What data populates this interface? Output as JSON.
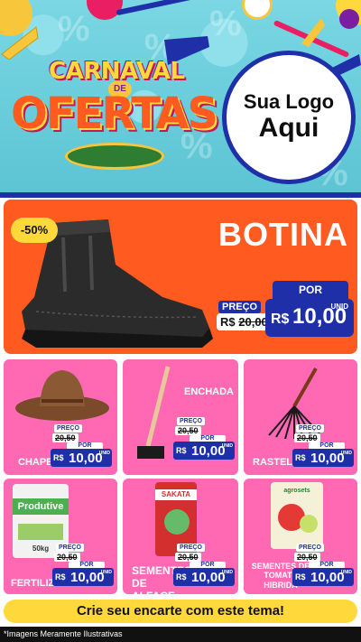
{
  "header": {
    "title_top": "CARNAVAL",
    "title_connector": "DE",
    "title_bottom": "OFERTAS",
    "brand_line1": "Sua Logo",
    "brand_line2": "Aqui"
  },
  "hero": {
    "product": "BOTINA",
    "discount": "-50%",
    "price_label": "PREÇO",
    "old_price_prefix": "R$",
    "old_price": "20,00",
    "por_label": "POR",
    "currency": "R$",
    "new_price": "10,00",
    "unit": "UNID"
  },
  "products": [
    {
      "name": "CHAPEU",
      "price_label": "PREÇO",
      "old_price": "20,50",
      "por_label": "POR",
      "currency": "R$",
      "new_price": "10,00",
      "unit": "UNID"
    },
    {
      "name": "ENCHADA",
      "price_label": "PREÇO",
      "old_price": "20,50",
      "por_label": "POR",
      "currency": "R$",
      "new_price": "10,00",
      "unit": "UNID"
    },
    {
      "name": "RASTELO",
      "price_label": "PREÇO",
      "old_price": "20,50",
      "por_label": "POR",
      "currency": "R$",
      "new_price": "10,00",
      "unit": "UNID"
    },
    {
      "name": "FERTILIZANTES",
      "price_label": "PREÇO",
      "old_price": "20,50",
      "por_label": "POR",
      "currency": "R$",
      "new_price": "10,00",
      "unit": "UNID"
    },
    {
      "name": "SEMENTES DE ALFACE",
      "price_label": "PREÇO",
      "old_price": "20,50",
      "por_label": "POR",
      "currency": "R$",
      "new_price": "10,00",
      "unit": "UNID"
    },
    {
      "name": "SEMENTES DE TOMATE HIBRIDA",
      "price_label": "PREÇO",
      "old_price": "20,50",
      "por_label": "POR",
      "currency": "R$",
      "new_price": "10,00",
      "unit": "UNID"
    }
  ],
  "product_images": {
    "fertilizer_brand": "Produtive",
    "fertilizer_weight": "50kg",
    "seed_brand": "SAKATA",
    "tomato_brand": "agrosets"
  },
  "cta": "Crie seu encarte com este tema!",
  "disclaimer": "*Imagens Meramente Ilustrativas",
  "colors": {
    "sky": "#6fd0dd",
    "hero_orange": "#ff5a1f",
    "card_pink": "#ff69b4",
    "price_blue": "#1f2fa8",
    "cta_yellow": "#ffd93b"
  }
}
